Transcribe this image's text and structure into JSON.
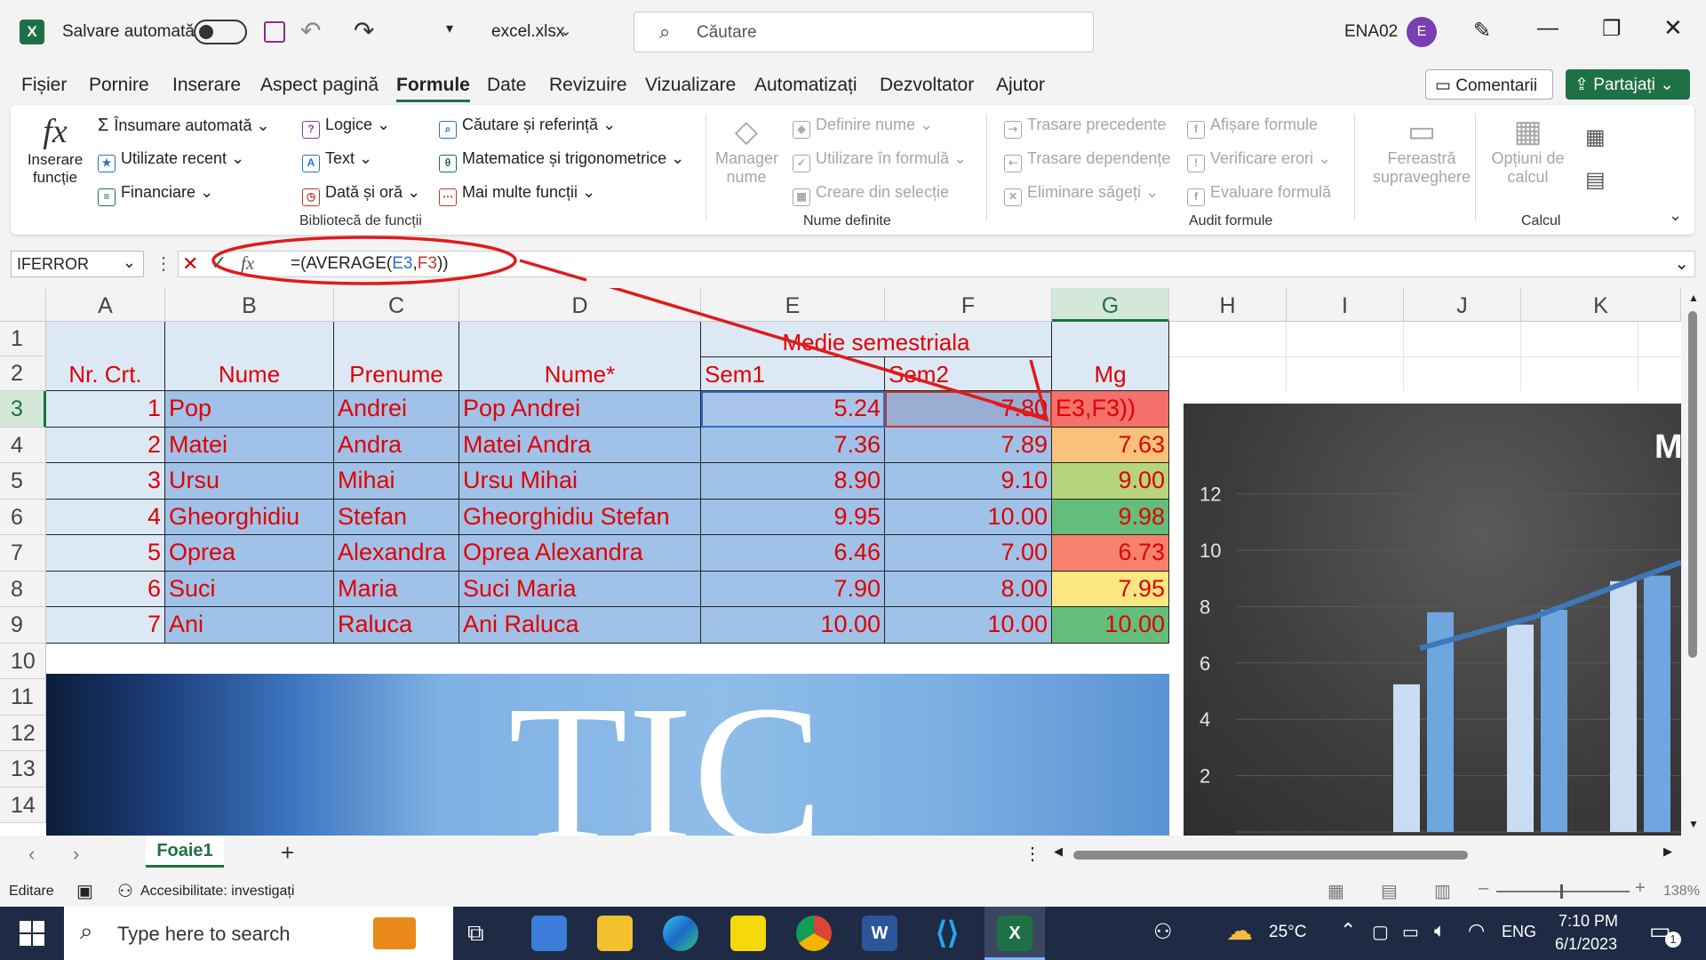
{
  "titlebar": {
    "autosave_label": "Salvare automată",
    "filename": "excel.xlsx",
    "search_placeholder": "Căutare",
    "user_name": "ENA02",
    "user_initial": "E"
  },
  "menu": {
    "items": [
      "Fișier",
      "Pornire",
      "Inserare",
      "Aspect pagină",
      "Formule",
      "Date",
      "Revizuire",
      "Vizualizare",
      "Automatizați",
      "Dezvoltator",
      "Ajutor"
    ],
    "active": "Formule",
    "comments_label": "Comentarii",
    "share_label": "Partajați"
  },
  "ribbon": {
    "insert_function": [
      "Inserare",
      "funcție"
    ],
    "library": {
      "autosum": "Însumare automată",
      "recent": "Utilizate recent",
      "financial": "Financiare",
      "logical": "Logice",
      "text": "Text",
      "datetime": "Dată și oră",
      "lookup": "Căutare și referință",
      "math": "Matematice și trigonometrice",
      "more": "Mai multe funcții",
      "group_label": "Bibliotecă de funcții"
    },
    "names": {
      "manager": [
        "Manager",
        "nume"
      ],
      "define": "Definire nume",
      "use_in_formula": "Utilizare în formulă",
      "create_from_selection": "Creare din selecție",
      "group_label": "Nume definite"
    },
    "audit": {
      "trace_precedents": "Trasare precedente",
      "trace_dependents": "Trasare dependențe",
      "remove_arrows": "Eliminare săgeți",
      "show_formulas": "Afișare formule",
      "error_check": "Verificare erori",
      "evaluate": "Evaluare formulă",
      "watch_window": [
        "Fereastră",
        "supraveghere"
      ],
      "group_label": "Audit formule"
    },
    "calc": {
      "options": [
        "Opțiuni de",
        "calcul"
      ],
      "group_label": "Calcul"
    }
  },
  "formulabar": {
    "name_box": "IFERROR",
    "formula_prefix": "=(AVERAGE(",
    "formula_ref1": "E3",
    "formula_comma": ",",
    "formula_ref2": "F3",
    "formula_suffix": "))"
  },
  "sheet": {
    "columns": [
      "A",
      "B",
      "C",
      "D",
      "E",
      "F",
      "G",
      "H",
      "I",
      "J",
      "K"
    ],
    "rows": [
      "1",
      "2",
      "3",
      "4",
      "5",
      "6",
      "7",
      "8",
      "9",
      "10",
      "11",
      "12",
      "13",
      "14"
    ],
    "merged_header": "Medie semestriala",
    "headers": [
      "Nr. Crt.",
      "Nume",
      "Prenume",
      "Nume*",
      "Sem1",
      "Sem2",
      "Mg"
    ],
    "data": [
      [
        "1",
        "Pop",
        "Andrei",
        "Pop Andrei",
        "5.24",
        "7.80",
        "E3,F3))"
      ],
      [
        "2",
        "Matei",
        "Andra",
        "Matei Andra",
        "7.36",
        "7.89",
        "7.63"
      ],
      [
        "3",
        "Ursu",
        "Mihai",
        "Ursu Mihai",
        "8.90",
        "9.10",
        "9.00"
      ],
      [
        "4",
        "Gheorghidiu",
        "Stefan",
        "Gheorghidiu Stefan",
        "9.95",
        "10.00",
        "9.98"
      ],
      [
        "5",
        "Oprea",
        "Alexandra",
        "Oprea Alexandra",
        "6.46",
        "7.00",
        "6.73"
      ],
      [
        "6",
        "Suci",
        "Maria",
        "Suci Maria",
        "7.90",
        "8.00",
        "7.95"
      ],
      [
        "7",
        "Ani",
        "Raluca",
        "Ani Raluca",
        "10.00",
        "10.00",
        "10.00"
      ]
    ],
    "mg_colors": [
      "#f4706b",
      "#f9c27b",
      "#b6d57a",
      "#63be7b",
      "#f8816d",
      "#fde783",
      "#63be7b"
    ],
    "watermark": "TIC",
    "chart": {
      "title_fragment": "M",
      "yticks": [
        "12",
        "10",
        "8",
        "6",
        "4",
        "2"
      ]
    }
  },
  "chart_data": {
    "type": "bar",
    "title": "M",
    "ylim": [
      0,
      14
    ],
    "yticks": [
      0,
      2,
      4,
      6,
      8,
      10,
      12
    ],
    "series": [
      {
        "values": [
          5.24,
          7.36,
          8.9
        ]
      },
      {
        "values": [
          7.8,
          7.89,
          9.1
        ]
      }
    ],
    "trendline": true
  },
  "tabs": {
    "sheet_name": "Foaie1",
    "add_label": "+"
  },
  "status": {
    "mode": "Editare",
    "accessibility": "Accesibilitate: investigați",
    "zoom": "138%"
  },
  "taskbar": {
    "search_placeholder": "Type here to search",
    "weather": "25°C",
    "lang": "ENG",
    "time": "7:10 PM",
    "date": "6/1/2023",
    "notif_count": "1"
  }
}
